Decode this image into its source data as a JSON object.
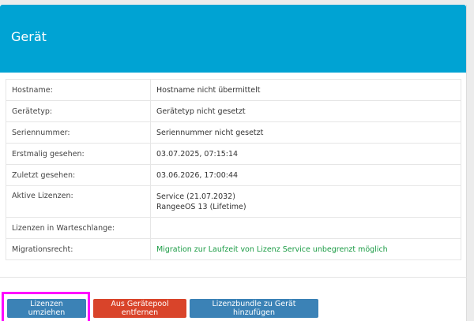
{
  "panel": {
    "title": "Gerät"
  },
  "details": [
    {
      "label": "Hostname:",
      "value": "Hostname nicht übermittelt"
    },
    {
      "label": "Gerätetyp:",
      "value": "Gerätetyp nicht gesetzt"
    },
    {
      "label": "Seriennummer:",
      "value": "Seriennummer nicht gesetzt"
    },
    {
      "label": "Erstmalig gesehen:",
      "value": "03.07.2025, 07:15:14"
    },
    {
      "label": "Zuletzt gesehen:",
      "value": "03.06.2026, 17:00:44"
    },
    {
      "label": "Aktive Lizenzen:",
      "values": [
        "Service (21.07.2032)",
        "RangeeOS 13 (Lifetime)"
      ]
    },
    {
      "label": "Lizenzen in Warteschlange:",
      "value": ""
    },
    {
      "label": "Migrationsrecht:",
      "value": "Migration zur Laufzeit von Lizenz Service unbegrenzt möglich"
    }
  ],
  "buttons": {
    "move_licenses": "Lizenzen umziehen",
    "remove_from_pool": "Aus Gerätepool entfernen",
    "add_bundle": "Lizenzbundle zu Gerät hinzufügen"
  },
  "colors": {
    "header": "#00a3d3",
    "primary": "#3b82b6",
    "danger": "#d9442a",
    "success_text": "#1a9b44",
    "highlight": "#ff00ff"
  }
}
